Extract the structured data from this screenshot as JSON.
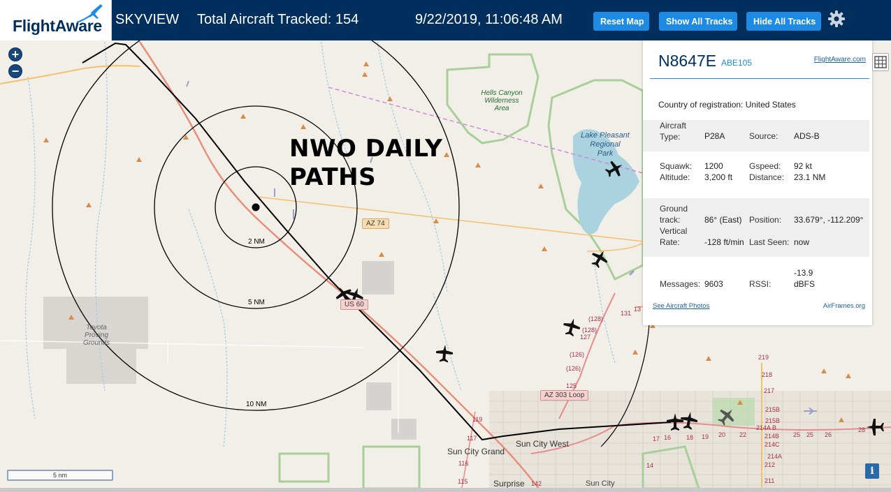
{
  "header": {
    "logo_text": "FlightAware",
    "app_name": "SKYVIEW",
    "aircraft_tracked": "Total Aircraft Tracked: 154",
    "datetime": "9/22/2019, 11:06:48 AM",
    "buttons": {
      "reset_map": "Reset Map",
      "show_all_tracks": "Show All Tracks",
      "hide_all_tracks": "Hide All Tracks"
    },
    "settings_icon": "gear-icon"
  },
  "map": {
    "zoom_in": "+",
    "zoom_out": "−",
    "overlay_title": [
      "NWO DAILY",
      "PATHS"
    ],
    "range_rings": [
      "2 NM",
      "5 NM",
      "10 NM"
    ],
    "roads": {
      "az74": "AZ 74",
      "us60": "US 60",
      "az303": "AZ 303 Loop"
    },
    "places": {
      "hells_canyon": [
        "Hells Canyon",
        "Wilderness",
        "Area"
      ],
      "lake_pleasant": [
        "Lake Pleasant",
        "Regional",
        "Park"
      ],
      "toyota": [
        "Toyota",
        "Proving",
        "Grounds"
      ],
      "sun_city_west": "Sun City West",
      "sun_city_grand": "Sun City Grand",
      "surprise": "Surprise",
      "sun_city": "Sun City"
    },
    "exits": [
      "119",
      "117",
      "116",
      "115",
      "(128)",
      "(128)",
      "127",
      "(126)",
      "(126)",
      "125",
      "131",
      "13",
      "142",
      "219",
      "218",
      "217",
      "215B",
      "215B",
      "214C",
      "214B",
      "214A",
      "212",
      "211",
      "214A B",
      "16",
      "17",
      "18",
      "19",
      "20",
      "22",
      "25",
      "25",
      "26",
      "28",
      "14"
    ],
    "scale_label": "5 nm",
    "colors": {
      "background": "#f2efe9",
      "track": "#000000",
      "us60_road": "#e6907a",
      "highway": "#f5c06b",
      "park_border": "#9ac28a",
      "water": "#aad3df",
      "airspace": "#c98bd6"
    }
  },
  "panel": {
    "ident": "N8647E",
    "callsign": "ABE105",
    "flightaware_link": "FlightAware.com",
    "country_label": "Country of registration:",
    "country_value": "United States",
    "aircraft_type_label": "Aircraft Type:",
    "aircraft_type_value": "P28A",
    "source_label": "Source:",
    "source_value": "ADS-B",
    "squawk_label": "Squawk:",
    "squawk_value": "1200",
    "altitude_label": "Altitude:",
    "altitude_value": "3,200 ft",
    "gspeed_label": "Gspeed:",
    "gspeed_value": "92 kt",
    "distance_label": "Distance:",
    "distance_value": "23.1 NM",
    "ground_track_label": "Ground track:",
    "ground_track_value": "86° (East)",
    "position_label": "Position:",
    "position_value": "33.679°, -112.209°",
    "vertical_rate_label": "Vertical Rate:",
    "vertical_rate_value": "-128 ft/min",
    "last_seen_label": "Last Seen:",
    "last_seen_value": "now",
    "messages_label": "Messages:",
    "messages_value": "9603",
    "rssi_label": "RSSI:",
    "rssi_value": "-13.9 dBFS",
    "see_photos": "See Aircraft Photos",
    "airframes": "AirFrames.org"
  },
  "corner": {
    "info": "i",
    "layers_icon": "layers-grid-icon"
  }
}
